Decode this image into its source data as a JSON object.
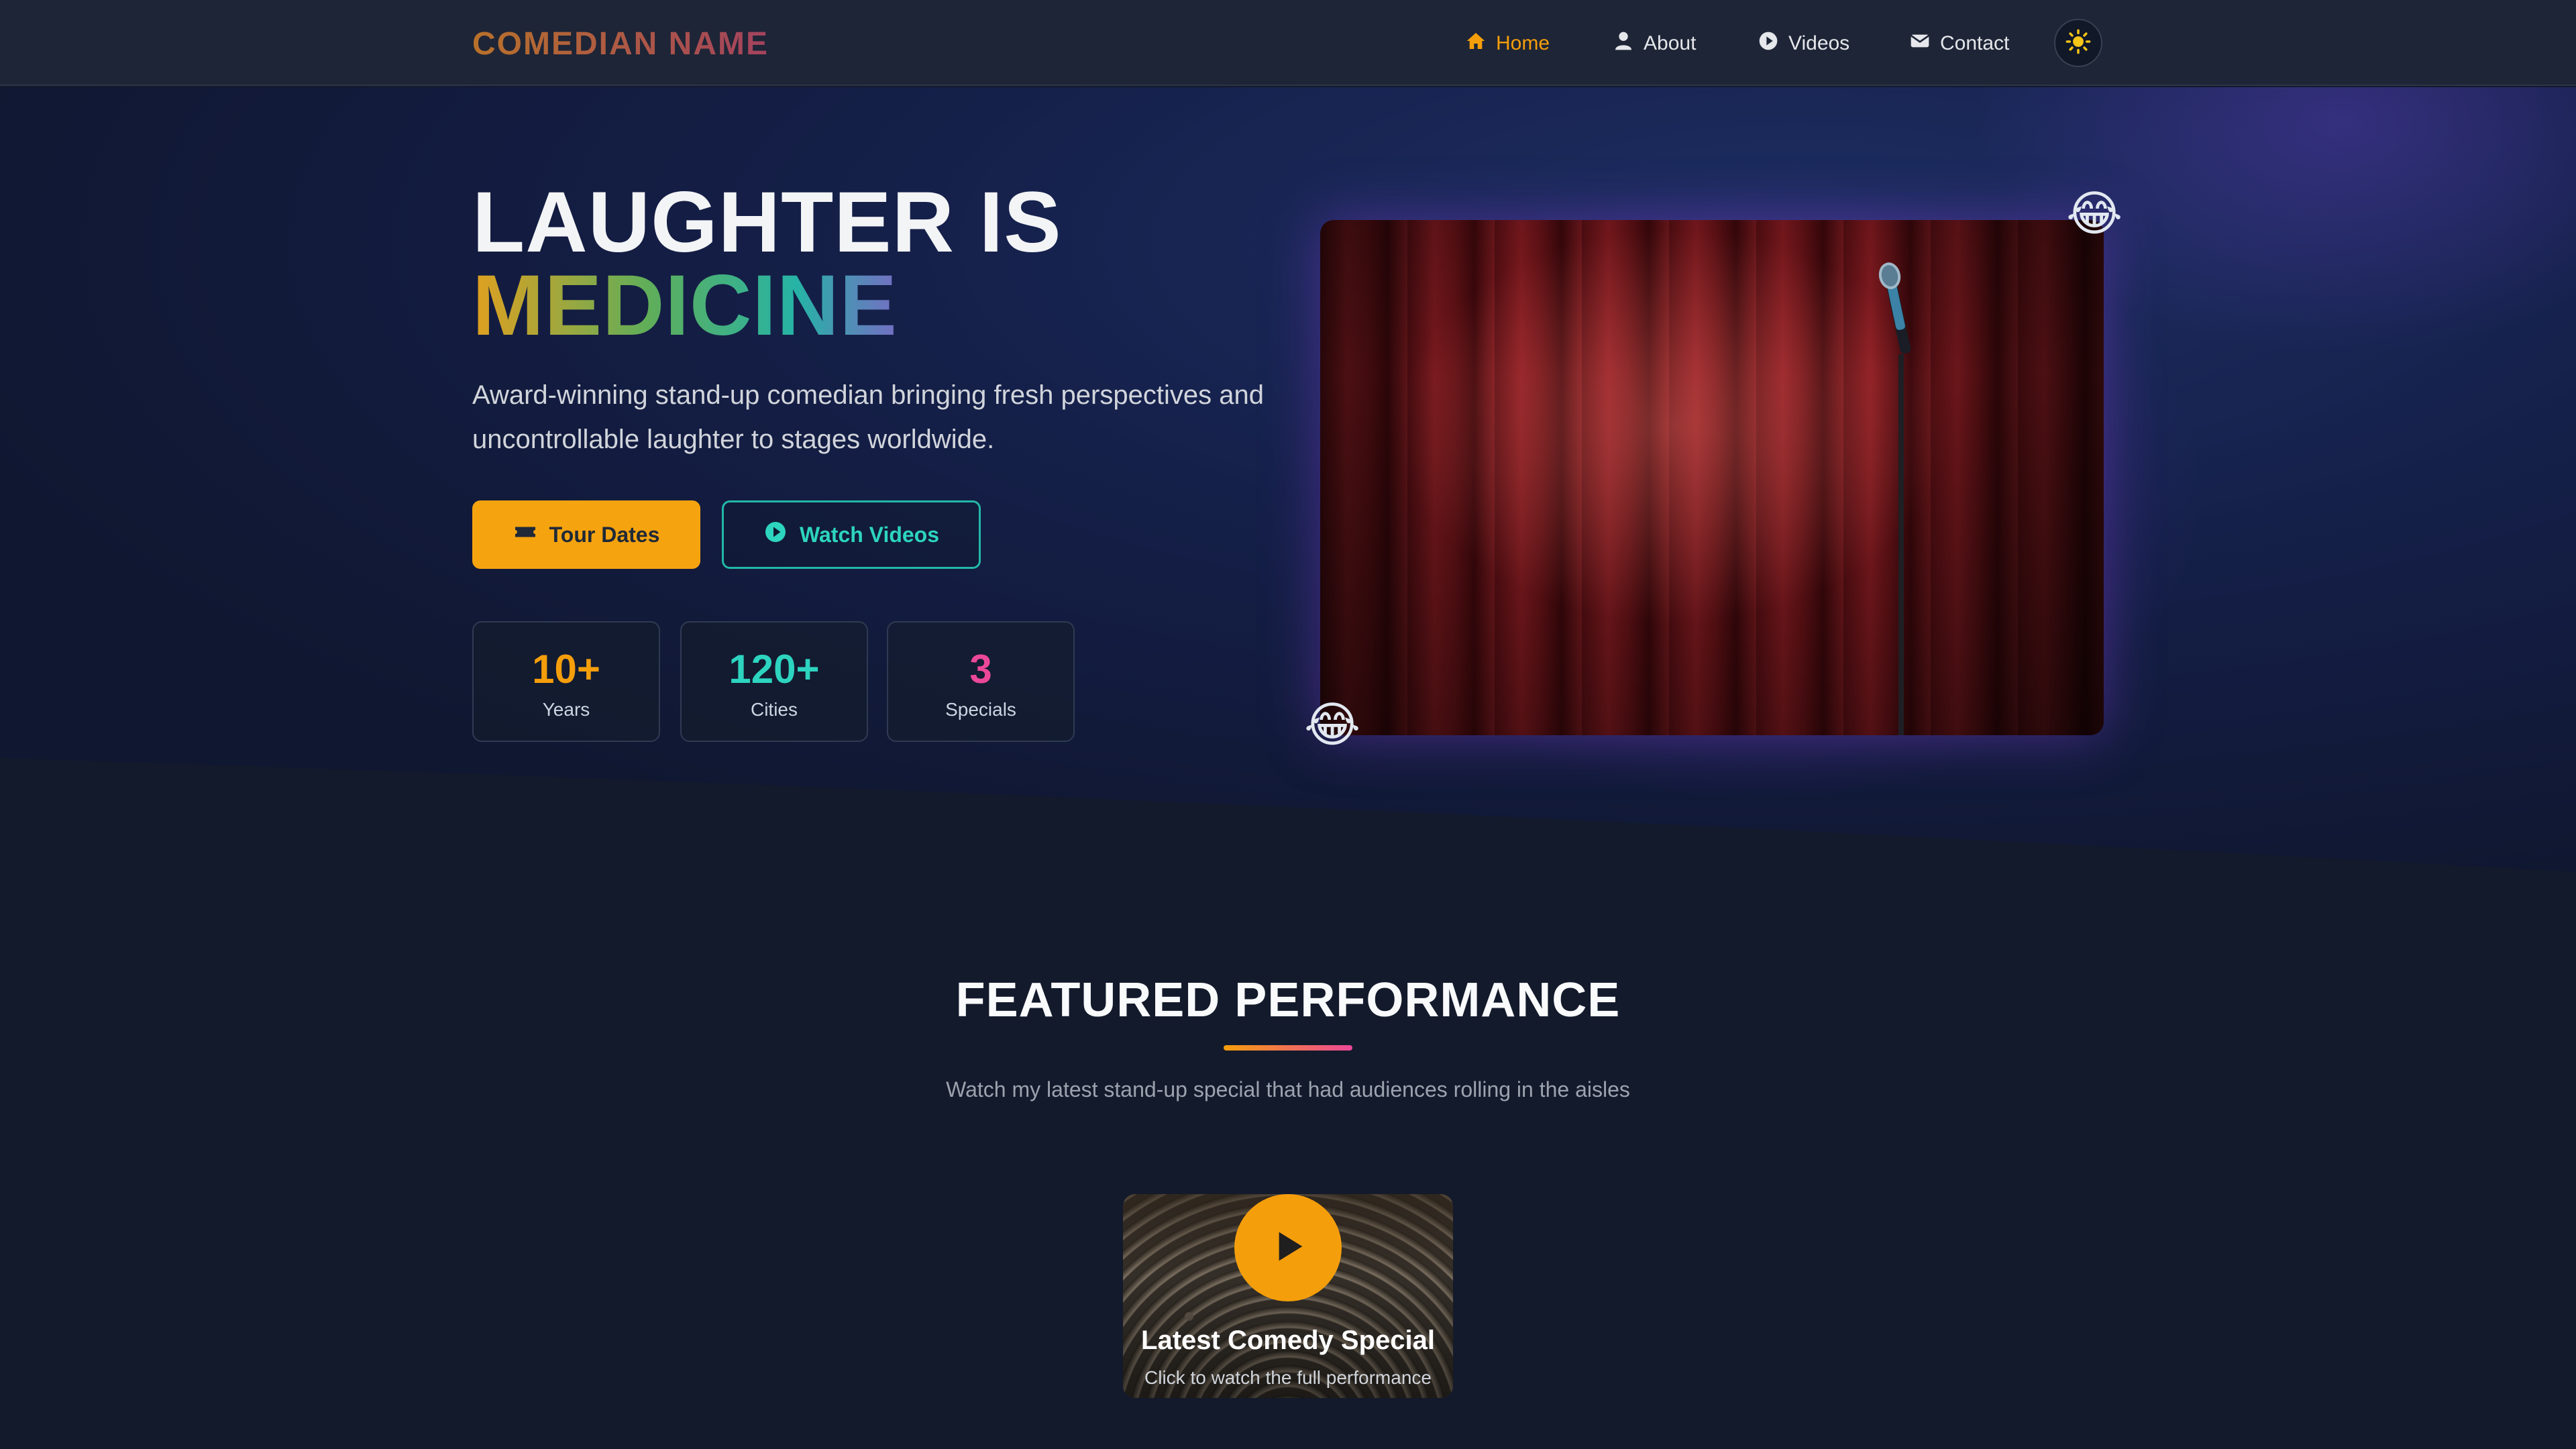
{
  "brand": {
    "name": "COMEDIAN NAME"
  },
  "nav": {
    "items": [
      {
        "label": "Home",
        "icon": "home-icon",
        "active": true
      },
      {
        "label": "About",
        "icon": "user-icon",
        "active": false
      },
      {
        "label": "Videos",
        "icon": "play-circle-icon",
        "active": false
      },
      {
        "label": "Contact",
        "icon": "envelope-icon",
        "active": false
      }
    ],
    "theme_toggle_icon": "sun-icon"
  },
  "hero": {
    "title_line1": "LAUGHTER IS",
    "title_line2": "MEDICINE",
    "subtitle": "Award-winning stand-up comedian bringing fresh perspectives and uncontrollable laughter to stages worldwide.",
    "primary_button": {
      "label": "Tour Dates",
      "icon": "ticket-icon"
    },
    "secondary_button": {
      "label": "Watch Videos",
      "icon": "play-circle-icon"
    },
    "stats": [
      {
        "value": "10+",
        "label": "Years",
        "color": "#f59e0b"
      },
      {
        "value": "120+",
        "label": "Cities",
        "color": "#2dd4bf"
      },
      {
        "value": "3",
        "label": "Specials",
        "color": "#ec4899"
      }
    ],
    "emoji_top": "😂",
    "emoji_bottom": "😂"
  },
  "featured": {
    "title": "FEATURED PERFORMANCE",
    "subtitle": "Watch my latest stand-up special that had audiences rolling in the aisles",
    "video": {
      "title": "Latest Comedy Special",
      "caption": "Click to watch the full performance",
      "icon": "play-icon"
    }
  },
  "colors": {
    "accent": "#f59e0b",
    "teal": "#2dd4bf",
    "pink": "#ec4899",
    "background": "#131a2b",
    "nav_background": "#1e2536"
  }
}
